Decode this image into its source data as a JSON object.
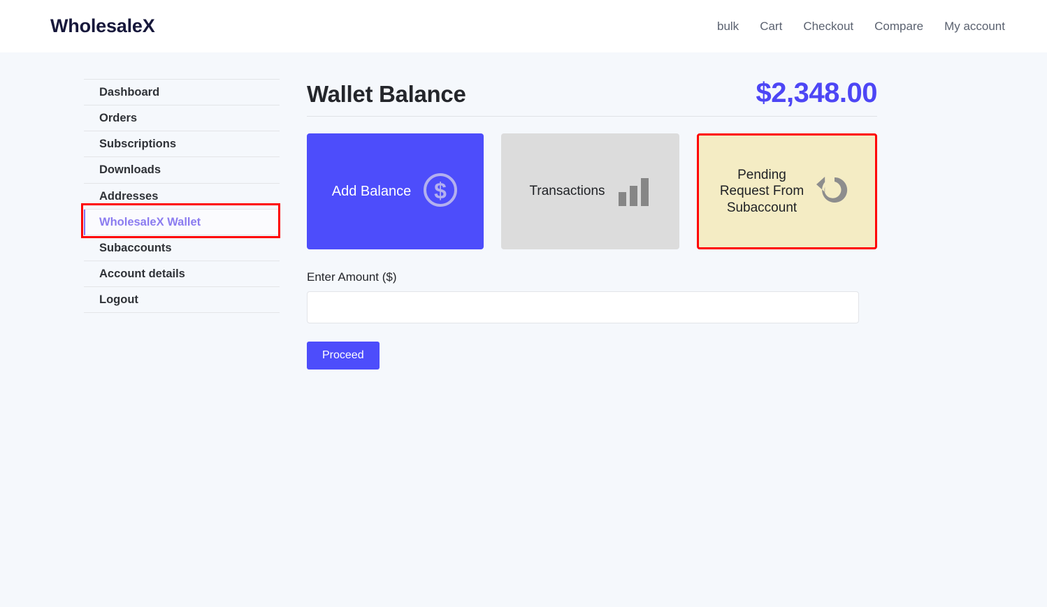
{
  "header": {
    "brand": "WholesaleX",
    "nav": [
      {
        "label": "bulk"
      },
      {
        "label": "Cart"
      },
      {
        "label": "Checkout"
      },
      {
        "label": "Compare"
      },
      {
        "label": "My account"
      }
    ]
  },
  "sidebar": {
    "items": [
      {
        "label": "Dashboard",
        "active": false
      },
      {
        "label": "Orders",
        "active": false
      },
      {
        "label": "Subscriptions",
        "active": false
      },
      {
        "label": "Downloads",
        "active": false
      },
      {
        "label": "Addresses",
        "active": false
      },
      {
        "label": "WholesaleX Wallet",
        "active": true
      },
      {
        "label": "Subaccounts",
        "active": false
      },
      {
        "label": "Account details",
        "active": false
      },
      {
        "label": "Logout",
        "active": false
      }
    ]
  },
  "wallet": {
    "title": "Wallet Balance",
    "balance": "$2,348.00",
    "cards": [
      {
        "label": "Add Balance",
        "icon": "dollar-circle-icon"
      },
      {
        "label": "Transactions",
        "icon": "bar-chart-icon"
      },
      {
        "label": "Pending\nRequest From\nSubaccount",
        "icon": "rotate-left-icon"
      }
    ],
    "form": {
      "amount_label": "Enter Amount ($)",
      "amount_value": "",
      "amount_placeholder": "",
      "submit_label": "Proceed"
    }
  },
  "colors": {
    "accent": "#4d4dfb",
    "balance_text": "#4d46f5",
    "card_transactions_bg": "#dcdcdc",
    "card_pending_bg": "#f4ecc4",
    "highlight_border": "#ff0000",
    "active_nav_text": "#8b7cf0",
    "page_bg": "#f5f8fc"
  }
}
